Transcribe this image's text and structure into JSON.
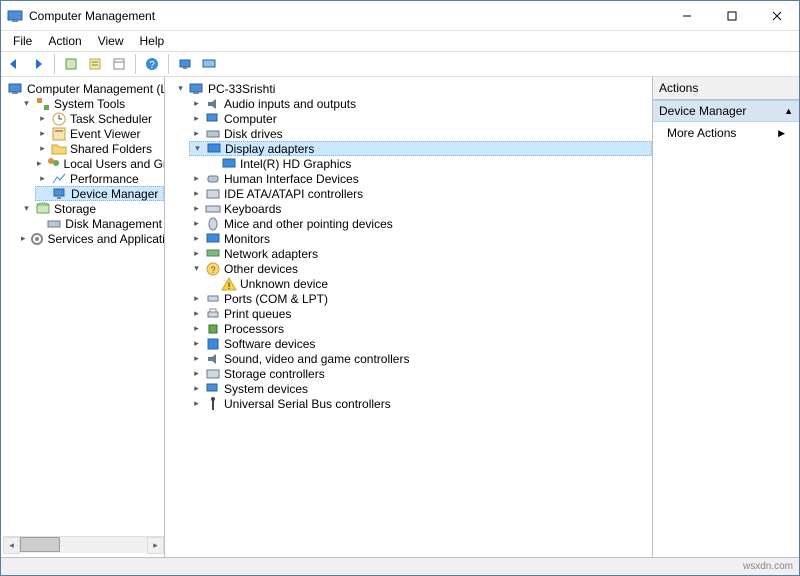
{
  "window": {
    "title": "Computer Management"
  },
  "menu": {
    "file": "File",
    "action": "Action",
    "view": "View",
    "help": "Help"
  },
  "left_tree": {
    "root": "Computer Management (Local",
    "system_tools": "System Tools",
    "task_scheduler": "Task Scheduler",
    "event_viewer": "Event Viewer",
    "shared_folders": "Shared Folders",
    "local_users": "Local Users and Groups",
    "performance": "Performance",
    "device_manager": "Device Manager",
    "storage": "Storage",
    "disk_management": "Disk Management",
    "services": "Services and Applications"
  },
  "center_tree": {
    "root": "PC-33Srishti",
    "audio": "Audio inputs and outputs",
    "computer": "Computer",
    "disk_drives": "Disk drives",
    "display_adapters": "Display adapters",
    "intel_hd": "Intel(R) HD Graphics",
    "hid": "Human Interface Devices",
    "ide": "IDE ATA/ATAPI controllers",
    "keyboards": "Keyboards",
    "mice": "Mice and other pointing devices",
    "monitors": "Monitors",
    "network": "Network adapters",
    "other_devices": "Other devices",
    "unknown_device": "Unknown device",
    "ports": "Ports (COM & LPT)",
    "print_queues": "Print queues",
    "processors": "Processors",
    "software_devices": "Software devices",
    "sound": "Sound, video and game controllers",
    "storage_ctrl": "Storage controllers",
    "system_devices": "System devices",
    "usb": "Universal Serial Bus controllers"
  },
  "actions": {
    "header": "Actions",
    "section": "Device Manager",
    "more": "More Actions"
  },
  "footer": "wsxdn.com"
}
